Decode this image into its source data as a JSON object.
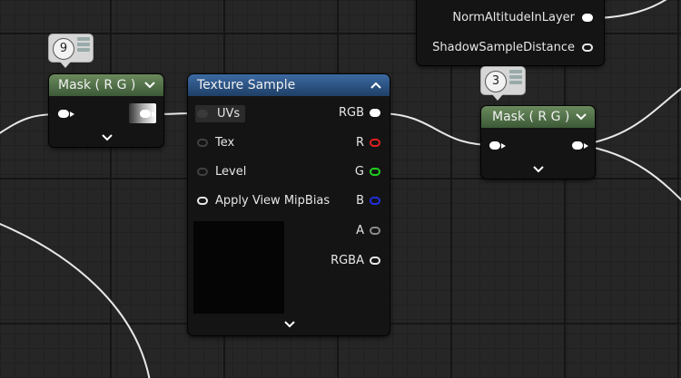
{
  "colors": {
    "mask_header": "#5a7a4f",
    "texture_header": "#2c5485",
    "node_body": "#141414",
    "pin_red": "#e02020",
    "pin_green": "#20d020",
    "pin_blue": "#2030e0"
  },
  "top_node": {
    "pins": [
      {
        "label": "NormAltitudeInLayer"
      },
      {
        "label": "ShadowSampleDistance"
      }
    ]
  },
  "mask_left": {
    "title": "Mask ( R G )",
    "comment_count": "9"
  },
  "texture_sample": {
    "title": "Texture Sample",
    "inputs": [
      {
        "label": "UVs"
      },
      {
        "label": "Tex"
      },
      {
        "label": "Level"
      },
      {
        "label": "Apply View MipBias"
      }
    ],
    "outputs": [
      {
        "label": "RGB"
      },
      {
        "label": "R"
      },
      {
        "label": "G"
      },
      {
        "label": "B"
      },
      {
        "label": "A"
      },
      {
        "label": "RGBA"
      }
    ]
  },
  "mask_right": {
    "title": "Mask ( R G )",
    "comment_count": "3"
  }
}
